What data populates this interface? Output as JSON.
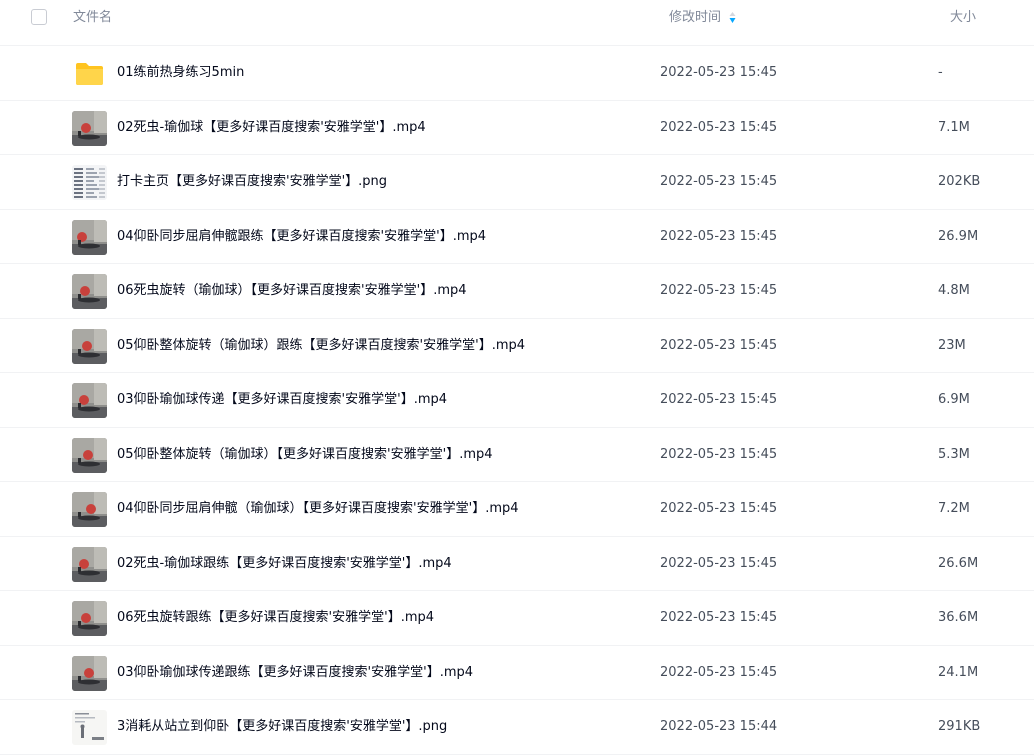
{
  "header": {
    "name_label": "文件名",
    "time_label": "修改时间",
    "size_label": "大小",
    "sort_color": "#06a7ff"
  },
  "files": [
    {
      "name": "01练前热身练习5min",
      "time": "2022-05-23 15:45",
      "size": "-",
      "thumb": "folder-icon"
    },
    {
      "name": "02死虫-瑜伽球【更多好课百度搜索'安雅学堂'】.mp4",
      "time": "2022-05-23 15:45",
      "size": "7.1M",
      "thumb": "video-thumbnail"
    },
    {
      "name": "打卡主页【更多好课百度搜索'安雅学堂'】.png",
      "time": "2022-05-23 15:45",
      "size": "202KB",
      "thumb": "image-thumbnail"
    },
    {
      "name": "04仰卧同步屈肩伸髋跟练【更多好课百度搜索'安雅学堂'】.mp4",
      "time": "2022-05-23 15:45",
      "size": "26.9M",
      "thumb": "video-thumbnail"
    },
    {
      "name": "06死虫旋转（瑜伽球）【更多好课百度搜索'安雅学堂'】.mp4",
      "time": "2022-05-23 15:45",
      "size": "4.8M",
      "thumb": "video-thumbnail"
    },
    {
      "name": "05仰卧整体旋转（瑜伽球）跟练【更多好课百度搜索'安雅学堂'】.mp4",
      "time": "2022-05-23 15:45",
      "size": "23M",
      "thumb": "video-thumbnail"
    },
    {
      "name": "03仰卧瑜伽球传递【更多好课百度搜索'安雅学堂'】.mp4",
      "time": "2022-05-23 15:45",
      "size": "6.9M",
      "thumb": "video-thumbnail"
    },
    {
      "name": "05仰卧整体旋转（瑜伽球）【更多好课百度搜索'安雅学堂'】.mp4",
      "time": "2022-05-23 15:45",
      "size": "5.3M",
      "thumb": "video-thumbnail"
    },
    {
      "name": "04仰卧同步屈肩伸髋（瑜伽球）【更多好课百度搜索'安雅学堂'】.mp4",
      "time": "2022-05-23 15:45",
      "size": "7.2M",
      "thumb": "video-thumbnail"
    },
    {
      "name": "02死虫-瑜伽球跟练【更多好课百度搜索'安雅学堂'】.mp4",
      "time": "2022-05-23 15:45",
      "size": "26.6M",
      "thumb": "video-thumbnail"
    },
    {
      "name": "06死虫旋转跟练【更多好课百度搜索'安雅学堂'】.mp4",
      "time": "2022-05-23 15:45",
      "size": "36.6M",
      "thumb": "video-thumbnail"
    },
    {
      "name": "03仰卧瑜伽球传递跟练【更多好课百度搜索'安雅学堂'】.mp4",
      "time": "2022-05-23 15:45",
      "size": "24.1M",
      "thumb": "video-thumbnail"
    },
    {
      "name": "3消耗从站立到仰卧【更多好课百度搜索'安雅学堂'】.png",
      "time": "2022-05-23 15:44",
      "size": "291KB",
      "thumb": "document-thumbnail"
    }
  ]
}
